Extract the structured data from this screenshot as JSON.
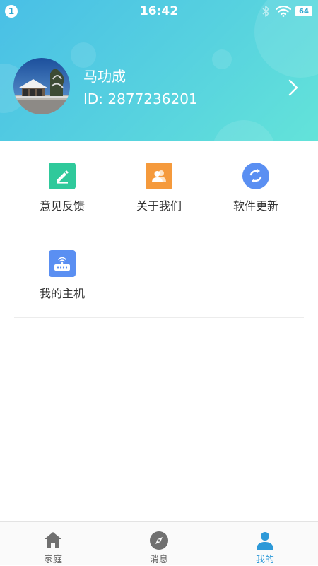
{
  "status_bar": {
    "notification_count": "1",
    "time": "16:42",
    "battery": "64"
  },
  "profile": {
    "name": "马功成",
    "id_text": "ID: 2877236201"
  },
  "grid": {
    "items": [
      {
        "label": "意见反馈",
        "icon": "edit-icon",
        "color": "#2fc99b"
      },
      {
        "label": "关于我们",
        "icon": "contacts-icon",
        "color": "#f59a3c"
      },
      {
        "label": "软件更新",
        "icon": "refresh-icon",
        "color": "#5a8ff2"
      },
      {
        "label": "我的主机",
        "icon": "router-icon",
        "color": "#5a8ff2"
      }
    ]
  },
  "tabbar": {
    "tabs": [
      {
        "label": "家庭",
        "icon": "home-icon"
      },
      {
        "label": "消息",
        "icon": "compass-icon"
      },
      {
        "label": "我的",
        "icon": "user-icon",
        "active": true
      }
    ]
  },
  "colors": {
    "header_gradient_start": "#49bfe6",
    "header_gradient_end": "#63e3d9",
    "accent": "#2d99d8",
    "inactive_tab": "#666666"
  }
}
